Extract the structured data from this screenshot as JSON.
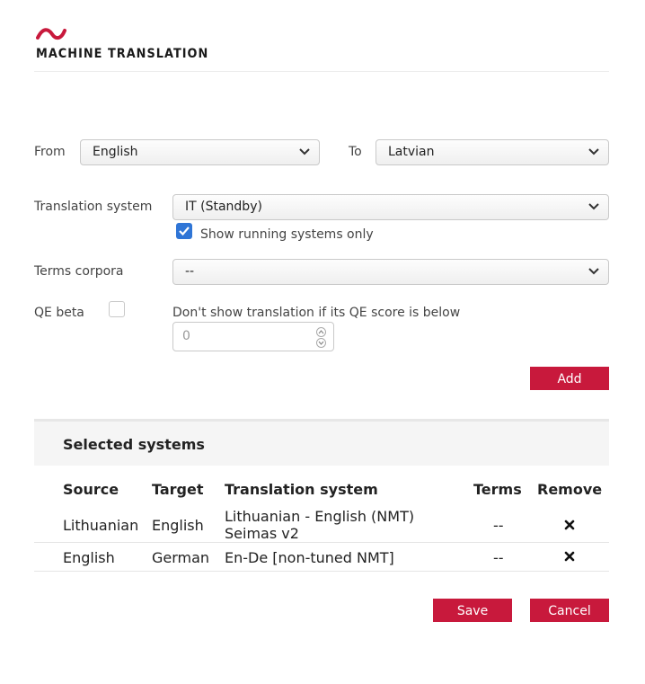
{
  "header": {
    "logo_text": "MACHINE TRANSLATION"
  },
  "form": {
    "from_label": "From",
    "from_value": "English",
    "to_label": "To",
    "to_value": "Latvian",
    "system_label": "Translation system",
    "system_value": "IT (Standby)",
    "running_only_label": "Show running systems only",
    "running_only_checked": true,
    "terms_label": "Terms corpora",
    "terms_value": "--",
    "qe_label": "QE beta",
    "qe_checked": false,
    "qe_threshold_label": "Don't show translation if its QE score is below",
    "qe_threshold_value": "0",
    "add_label": "Add"
  },
  "selected": {
    "title": "Selected systems",
    "columns": [
      "Source",
      "Target",
      "Translation system",
      "Terms",
      "Remove"
    ],
    "rows": [
      {
        "source": "Lithuanian",
        "target": "English",
        "system_line1": "Lithuanian - English (NMT)",
        "system_line2": "Seimas v2",
        "terms": "--",
        "remove_icon": "x-icon"
      },
      {
        "source": "English",
        "target": "German",
        "system_line1": "En-De [non-tuned NMT]",
        "system_line2": "",
        "terms": "--",
        "remove_icon": "x-icon"
      }
    ]
  },
  "actions": {
    "save_label": "Save",
    "cancel_label": "Cancel"
  },
  "colors": {
    "brand": "#c8193c",
    "checkbox": "#2f75d6"
  }
}
